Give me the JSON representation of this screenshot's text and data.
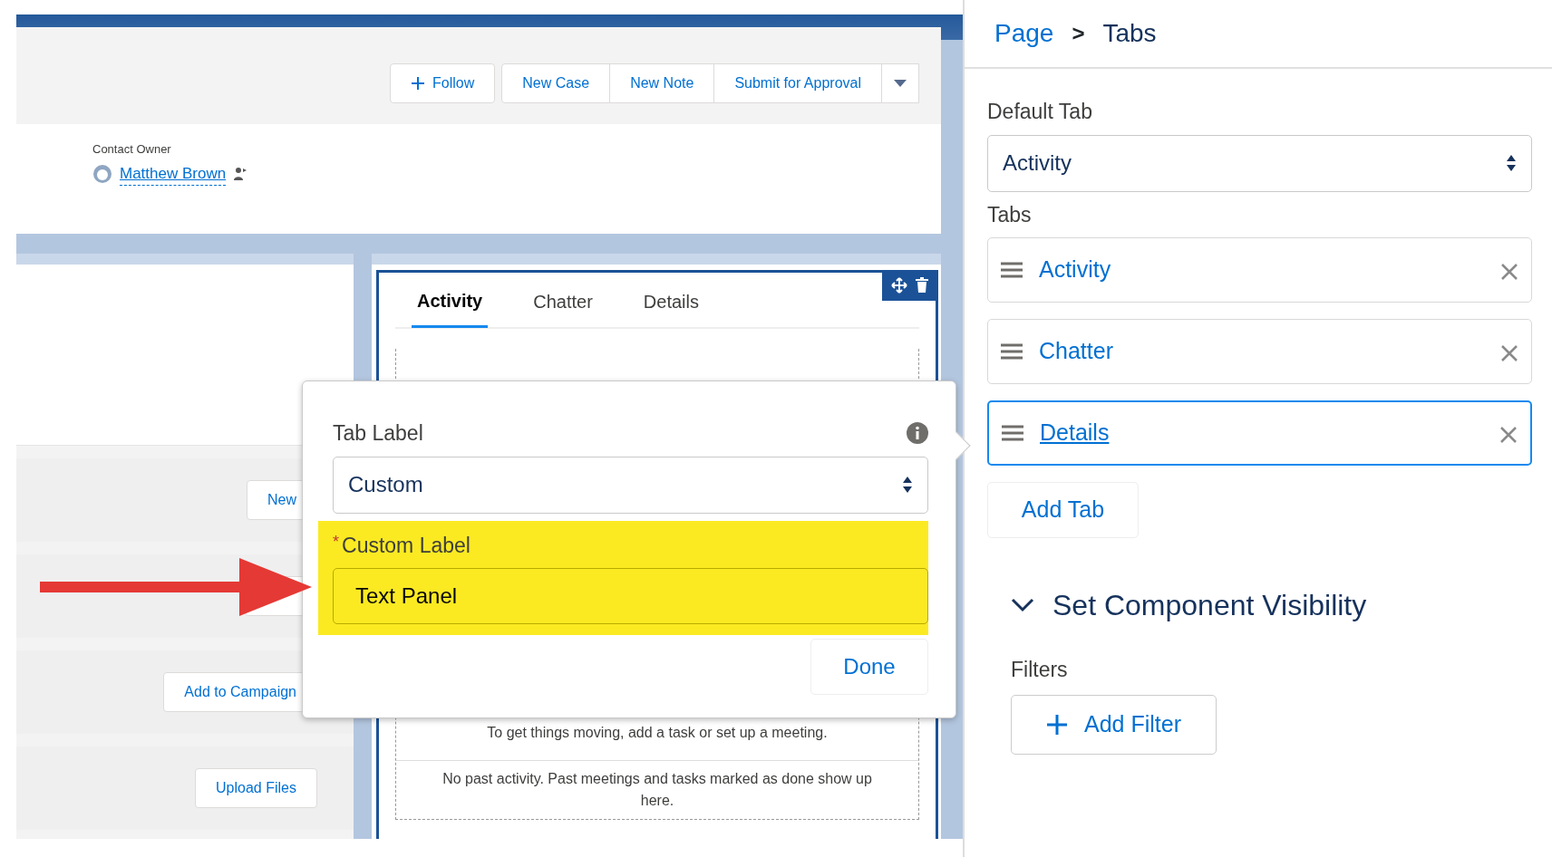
{
  "header": {
    "actions": [
      {
        "label": "Follow",
        "kind": "follow"
      },
      {
        "label": "New Case",
        "kind": "plain"
      },
      {
        "label": "New Note",
        "kind": "plain"
      },
      {
        "label": "Submit for Approval",
        "kind": "plain"
      }
    ],
    "owner_label": "Contact Owner",
    "owner_name": "Matthew Brown"
  },
  "left_actions": [
    "New",
    "Add to Campaign",
    "Upload Files"
  ],
  "tabs": [
    {
      "label": "Activity",
      "selected": true
    },
    {
      "label": "Chatter",
      "selected": false
    },
    {
      "label": "Details",
      "selected": false
    }
  ],
  "activity_messages": [
    "To get things moving, add a task or set up a meeting.",
    "No past activity. Past meetings and tasks marked as done show up here."
  ],
  "popover": {
    "tab_label": "Tab Label",
    "tab_label_value": "Custom",
    "custom_label": "Custom Label",
    "required_mark": "*",
    "custom_label_value": "Text Panel",
    "done": "Done"
  },
  "panel": {
    "breadcrumb": [
      {
        "label": "Page",
        "kind": "link"
      },
      {
        "label": "Tabs",
        "kind": "current"
      }
    ],
    "separator": ">",
    "default_tab_label": "Default Tab",
    "default_tab_value": "Activity",
    "tabs_label": "Tabs",
    "tab_items": [
      {
        "label": "Activity",
        "selected": false
      },
      {
        "label": "Chatter",
        "selected": false
      },
      {
        "label": "Details",
        "selected": true
      }
    ],
    "add_tab": "Add Tab",
    "visibility": {
      "title": "Set Component Visibility",
      "expanded": true
    },
    "filters_label": "Filters",
    "add_filter": "Add Filter"
  }
}
